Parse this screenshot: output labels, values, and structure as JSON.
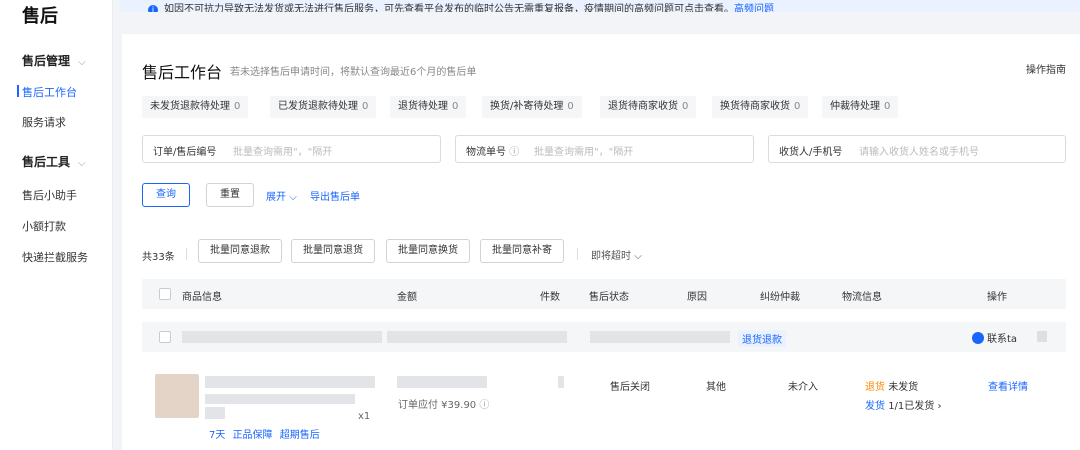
{
  "sidebar": {
    "title": "售后",
    "groups": [
      {
        "label": "售后管理",
        "items": [
          "售后工作台",
          "服务请求"
        ]
      },
      {
        "label": "售后工具",
        "items": [
          "售后小助手",
          "小额打款",
          "快递拦截服务"
        ]
      }
    ]
  },
  "notice": {
    "text": "如因不可抗力导致无法发货或无法进行售后服务，可先查看平台发布的临时公告无需重复报备，疫情期间的高频问题可点击查看。",
    "link": "高频问题"
  },
  "header": {
    "title": "售后工作台",
    "subtitle": "若未选择售后申请时间，将默认查询最近6个月的售后单",
    "guide": "操作指南"
  },
  "status_chips": [
    {
      "label": "未发货退款待处理",
      "count": "0"
    },
    {
      "label": "已发货退款待处理",
      "count": "0"
    },
    {
      "label": "退货待处理",
      "count": "0"
    },
    {
      "label": "换货/补寄待处理",
      "count": "0"
    },
    {
      "label": "退货待商家收货",
      "count": "0"
    },
    {
      "label": "换货待商家收货",
      "count": "0"
    },
    {
      "label": "仲裁待处理",
      "count": "0"
    }
  ],
  "filters": {
    "order": {
      "label": "订单/售后编号",
      "placeholder": "批量查询需用\"，\"隔开"
    },
    "logistics": {
      "label": "物流单号",
      "placeholder": "批量查询需用\"，\"隔开"
    },
    "receiver": {
      "label": "收货人/手机号",
      "placeholder": "请输入收货人姓名或手机号"
    }
  },
  "actions": {
    "query": "查询",
    "reset": "重置",
    "expand": "展开",
    "export": "导出售后单"
  },
  "batch": {
    "total": "共33条",
    "buttons": [
      "批量同意退款",
      "批量同意退货",
      "批量同意换货",
      "批量同意补寄"
    ],
    "soon": "即将超时"
  },
  "table": {
    "headers": [
      "商品信息",
      "金额",
      "件数",
      "售后状态",
      "原因",
      "纠纷仲裁",
      "物流信息",
      "操作"
    ]
  },
  "group_row": {
    "type_tag": "退货退款",
    "contact": "联系ta"
  },
  "row": {
    "qty": "x1",
    "amount": "订单应付 ¥39.90",
    "status": "售后关闭",
    "reason": "其他",
    "dispute": "未介入",
    "return_tag": "退货",
    "return_status": "未发货",
    "ship_tag": "发货",
    "ship_status": "1/1已发货 ›",
    "action": "查看详情",
    "tags": [
      "7天",
      "正品保障",
      "超期售后"
    ]
  },
  "colors": {
    "accent": "#1966ff",
    "orange": "#ff8a00",
    "background": "#f3f4f7"
  }
}
